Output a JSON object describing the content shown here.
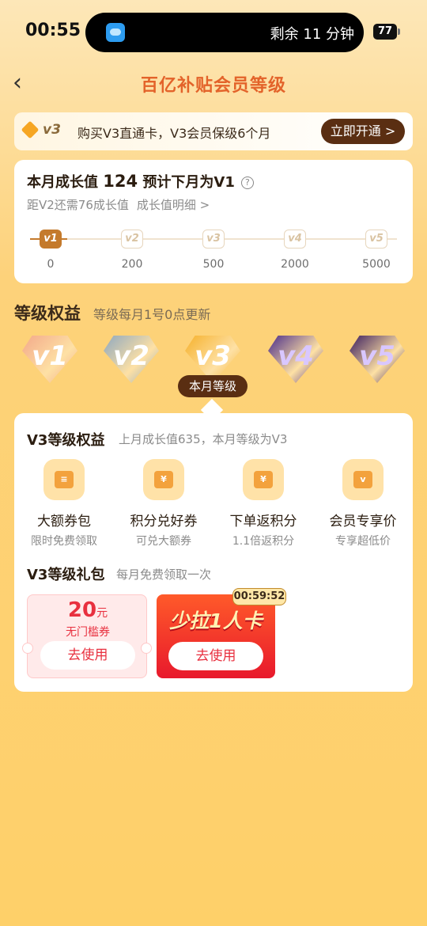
{
  "status": {
    "time": "00:55",
    "island_text": "剩余 11 分钟",
    "battery": "77"
  },
  "nav": {
    "title": "百亿补贴会员等级"
  },
  "promo": {
    "badge": "v3",
    "text": "购买V3直通卡，V3会员保级6个月",
    "button": "立即开通 >"
  },
  "growth": {
    "title_prefix": "本月成长值",
    "value": "124",
    "title_suffix": "预计下月为V1",
    "need_text": "距V2还需76成长值",
    "detail_link": "成长值明细 >",
    "progress_to_v2": 0.62,
    "levels": [
      {
        "label": "v1",
        "threshold": "0"
      },
      {
        "label": "v2",
        "threshold": "200"
      },
      {
        "label": "v3",
        "threshold": "500"
      },
      {
        "label": "v4",
        "threshold": "2000"
      },
      {
        "label": "v5",
        "threshold": "5000"
      }
    ]
  },
  "benefits": {
    "title": "等级权益",
    "subtitle": "等级每月1号0点更新",
    "gems": [
      {
        "label": "v1",
        "color": "#f3a98a"
      },
      {
        "label": "v2",
        "color": "#8fa8c0"
      },
      {
        "label": "v3",
        "color": "#f6b12c"
      },
      {
        "label": "v4",
        "color": "#4a2c8a"
      },
      {
        "label": "v5",
        "color": "#3a1c5e"
      }
    ],
    "current_badge": "本月等级"
  },
  "level_card": {
    "title": "V3等级权益",
    "subtitle": "上月成长值635，本月等级为V3",
    "items": [
      {
        "title": "大额券包",
        "sub": "限时免费领取",
        "icon": "coupon-pack-icon"
      },
      {
        "title": "积分兑好券",
        "sub": "可兑大额券",
        "icon": "points-coupon-icon"
      },
      {
        "title": "下单返积分",
        "sub": "1.1倍返积分",
        "icon": "points-return-icon"
      },
      {
        "title": "会员专享价",
        "sub": "专享超低价",
        "icon": "member-price-icon"
      }
    ],
    "gift_title": "V3等级礼包",
    "gift_subtitle": "每月免费领取一次",
    "coupon": {
      "amount": "20",
      "unit": "元",
      "desc": "无门槛券",
      "button": "去使用"
    },
    "card": {
      "title": "少拉1人卡",
      "timer": "00:59:52",
      "button": "去使用"
    }
  }
}
